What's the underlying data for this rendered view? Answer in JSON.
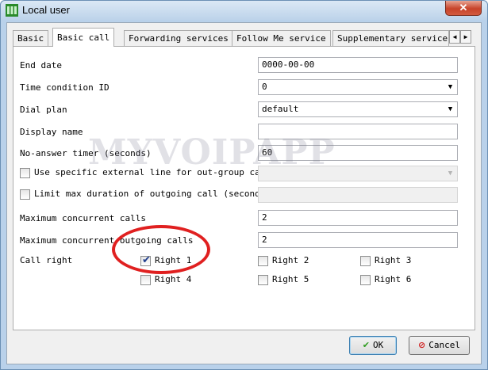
{
  "window": {
    "title": "Local user",
    "close_glyph": "✕",
    "app_icon": "local-user-app-icon"
  },
  "tabs": {
    "items": [
      {
        "label": "Basic",
        "active": false
      },
      {
        "label": "Basic call",
        "active": true
      },
      {
        "label": "Forwarding services",
        "active": false
      },
      {
        "label": "Follow Me service",
        "active": false
      },
      {
        "label": "Supplementary services",
        "active": false
      }
    ],
    "scroll_left": "◀",
    "scroll_right": "▶"
  },
  "form": {
    "end_date": {
      "label": "End date",
      "value": "0000-00-00"
    },
    "time_condition": {
      "label": "Time condition ID",
      "value": "0"
    },
    "dial_plan": {
      "label": "Dial plan",
      "value": "default"
    },
    "display_name": {
      "label": "Display name",
      "value": ""
    },
    "no_answer_timer": {
      "label": "No-answer timer (seconds)",
      "value": "60"
    },
    "external_line": {
      "label": "Use specific external line for out-group call",
      "checked": false,
      "value": ""
    },
    "limit_duration": {
      "label": "Limit max duration of outgoing call (seconds)",
      "checked": false,
      "value": ""
    },
    "max_concurrent": {
      "label": "Maximum concurrent calls",
      "value": "2"
    },
    "max_concurrent_out": {
      "label": "Maximum concurrent outgoing calls",
      "value": "2"
    },
    "call_right": {
      "label": "Call right",
      "rights": [
        {
          "label": "Right 1",
          "checked": true
        },
        {
          "label": "Right 2",
          "checked": false
        },
        {
          "label": "Right 3",
          "checked": false
        },
        {
          "label": "Right 4",
          "checked": false
        },
        {
          "label": "Right 5",
          "checked": false
        },
        {
          "label": "Right 6",
          "checked": false
        }
      ]
    }
  },
  "buttons": {
    "ok": "OK",
    "cancel": "Cancel",
    "ok_icon": "✔",
    "cancel_icon": "⊘"
  },
  "check_glyph": "✔",
  "combo_arrow": "▼",
  "watermark": "MYVOIPAPP",
  "colors": {
    "ok_icon": "#2e9b1f",
    "cancel_icon": "#d02020",
    "annotation": "#e02020"
  }
}
